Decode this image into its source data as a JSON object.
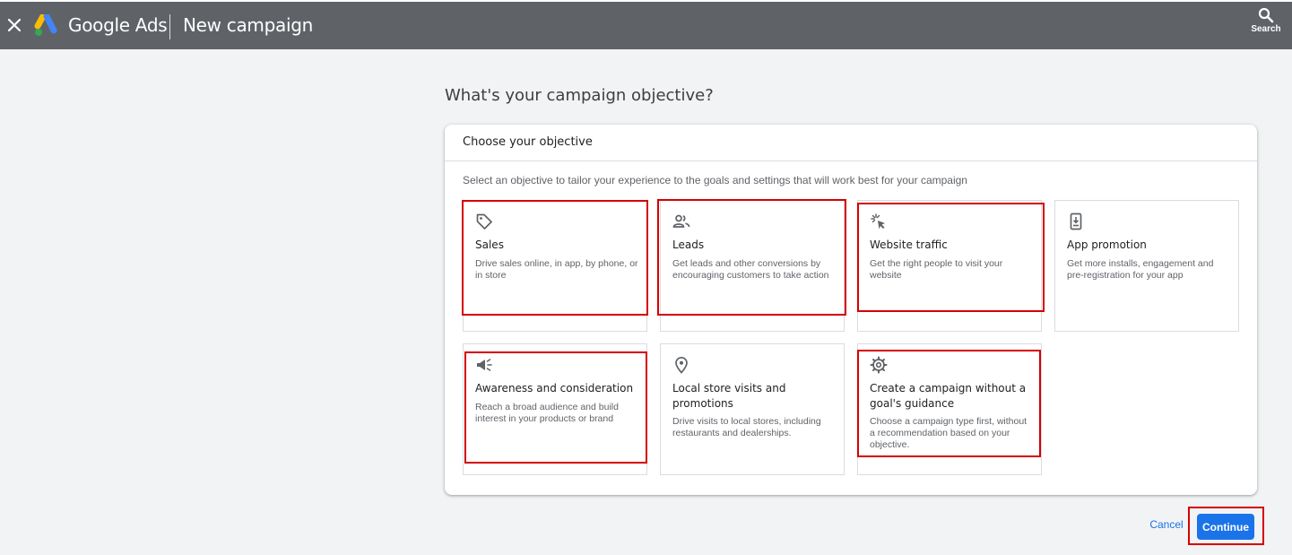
{
  "topbar": {
    "brand": "Google Ads",
    "page_title": "New campaign",
    "search_label": "Search",
    "background": "#5f6368"
  },
  "heading": "What's your campaign objective?",
  "card": {
    "header": "Choose your objective",
    "description": "Select an objective to tailor your experience to the goals and settings that will work best for your campaign"
  },
  "objectives": [
    {
      "icon": "tag-icon",
      "title": "Sales",
      "description": "Drive sales online, in app, by phone, or in store"
    },
    {
      "icon": "people-icon",
      "title": "Leads",
      "description": "Get leads and other conversions by encouraging customers to take action"
    },
    {
      "icon": "cursor-click-icon",
      "title": "Website traffic",
      "description": "Get the right people to visit your website"
    },
    {
      "icon": "phone-download-icon",
      "title": "App promotion",
      "description": "Get more installs, engagement and pre-registration for your app"
    },
    {
      "icon": "megaphone-icon",
      "title": "Awareness and consideration",
      "description": "Reach a broad audience and build interest in your products or brand"
    },
    {
      "icon": "location-pin-icon",
      "title": "Local store visits and promotions",
      "description": "Drive visits to local stores, including restaurants and dealerships."
    },
    {
      "icon": "gear-icon",
      "title": "Create a campaign without a goal's guidance",
      "description": "Choose a campaign type first, without a recommendation based on your objective."
    }
  ],
  "actions": {
    "cancel": "Cancel",
    "continue": "Continue"
  },
  "colors": {
    "accent": "#1a73e8",
    "highlight": "#d50000"
  }
}
